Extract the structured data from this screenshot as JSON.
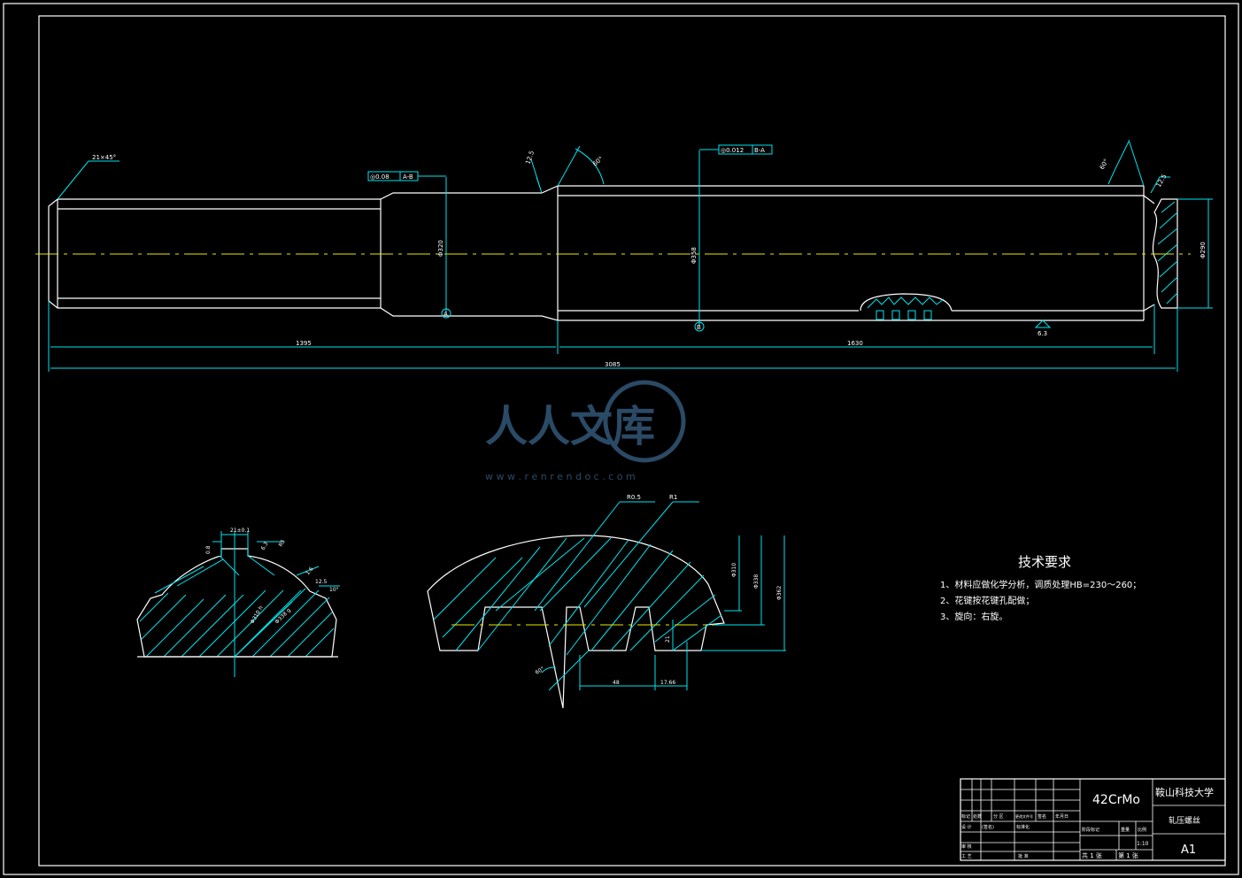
{
  "dimensions": {
    "chamfer_left": "21×45°",
    "tol_a": "◎0.08",
    "tol_a_ref": "A-B",
    "tol_b": "◎0.012",
    "tol_b_ref": "B-A",
    "rough1": "12.5",
    "angle1": "60°",
    "angle2": "60°",
    "rough2": "12.5",
    "dia_a": "Φ320",
    "dia_b": "Φ358",
    "dia_end": "Φ290",
    "datum_a": "A",
    "datum_b": "B",
    "rough3": "6.3",
    "len_left": "1395",
    "len_right": "1630",
    "len_total": "3085",
    "r05": "R0.5",
    "r1": "R1",
    "d310": "Φ310",
    "d338": "Φ338",
    "d362": "Φ362",
    "d21": "21",
    "d48": "48",
    "d1766": "17.66",
    "ang_bottom": "60°",
    "spline_width": "21±0.1",
    "spline_small": [
      "0.8",
      "6.3",
      "R5",
      "1.6",
      "12.5",
      "10°"
    ],
    "spline_dia1": "Φ310 h",
    "spline_dia2": "Φ338 g"
  },
  "watermark": {
    "logo_text": "人人文库",
    "url": "w w w . r e n r e n d o c . c o m"
  },
  "tech": {
    "title": "技术要求",
    "items": [
      "1、材料应做化学分析，调质处理HB=230～260；",
      "2、花键按花键孔配做；",
      "3、旋向：右旋。"
    ]
  },
  "title_block": {
    "material": "42CrMo",
    "school": "鞍山科技大学",
    "part_name": "轧压螺丝",
    "sheet_size": "A1",
    "scale": "1:10",
    "total_sheets": "共 1 张",
    "sheet_no": "第 1 张",
    "labels": [
      "标记",
      "处数",
      "分 区",
      "更改文件号",
      "签名",
      "年月日"
    ],
    "labels2": [
      "设 计",
      "标准化"
    ],
    "labels3": [
      "审 核",
      "工 艺",
      "批 准"
    ],
    "mid_labels": [
      "阶段标记",
      "重量",
      "比例"
    ],
    "designer": "(签名)"
  }
}
